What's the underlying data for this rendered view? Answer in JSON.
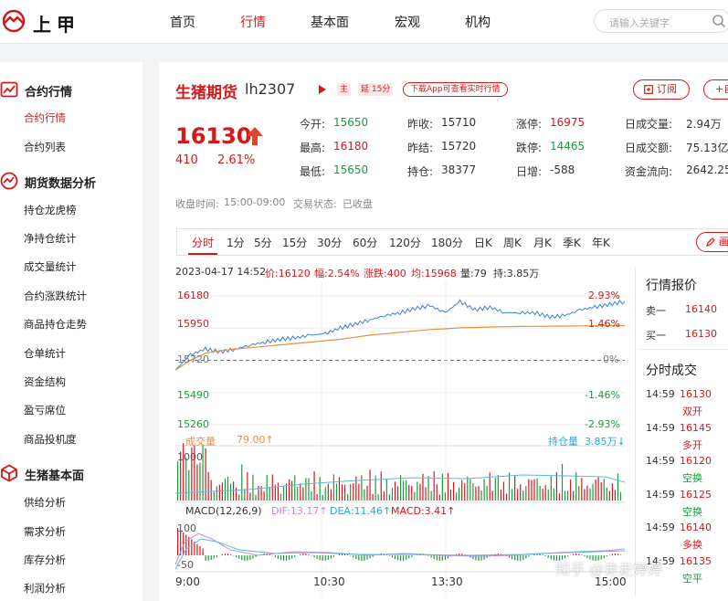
{
  "brand": {
    "name": "上甲",
    "accent": "#d5181c",
    "up": "#d5181c",
    "down": "#1a9b3a"
  },
  "nav": [
    "首页",
    "行情",
    "基本面",
    "宏观",
    "机构"
  ],
  "search": {
    "placeholder": "请输入关键字"
  },
  "sidebar": [
    {
      "title": "合约行情",
      "icon": "chart-line-icon",
      "items": [
        "合约行情",
        "合约列表"
      ],
      "active": "合约行情"
    },
    {
      "title": "期货数据分析",
      "icon": "trend-icon",
      "items": [
        "持仓龙虎榜",
        "净持仓统计",
        "成交量统计",
        "合约涨跌统计",
        "商品持仓走势",
        "仓单统计",
        "资金结构",
        "盈亏席位",
        "商品投机度"
      ]
    },
    {
      "title": "生猪基本面",
      "icon": "cube-icon",
      "items": [
        "供给分析",
        "需求分析",
        "库存分析",
        "利润分析"
      ]
    }
  ],
  "contract": {
    "name": "生猪期货",
    "code": "lh2307",
    "tag_main": "主",
    "tag_delay": "延 15分",
    "app_tip": "下载App可查看实时行情",
    "subscribe": "订阅",
    "add": "+自",
    "price": "16130",
    "change": "410",
    "change_pct": "2.61%",
    "status_time_label": "收盘时间:",
    "status_time": "15:00-09:00",
    "trade_status_label": "交易状态:",
    "trade_status": "已收盘"
  },
  "quote": [
    {
      "label": "今开:",
      "value": "15650",
      "color": "green"
    },
    {
      "label": "昨收:",
      "value": "15710",
      "color": "plain"
    },
    {
      "label": "涨停:",
      "value": "16975",
      "color": "red"
    },
    {
      "label": "日成交量:",
      "value": "2.94万",
      "color": "plain"
    },
    {
      "label": "最高:",
      "value": "16180",
      "color": "red"
    },
    {
      "label": "昨结:",
      "value": "15720",
      "color": "plain"
    },
    {
      "label": "跌停:",
      "value": "14465",
      "color": "green"
    },
    {
      "label": "日成交额:",
      "value": "75.13亿",
      "color": "plain"
    },
    {
      "label": "最低:",
      "value": "15650",
      "color": "green"
    },
    {
      "label": "持仓:",
      "value": "38377",
      "color": "plain"
    },
    {
      "label": "日增:",
      "value": "-588",
      "color": "plain"
    },
    {
      "label": "资金流向:",
      "value": "2642.25",
      "color": "plain"
    }
  ],
  "tabs": [
    "分时",
    "1分",
    "5分",
    "15分",
    "30分",
    "60分",
    "120分",
    "180分",
    "日K",
    "周K",
    "月K",
    "季K",
    "年K"
  ],
  "active_tab": "分时",
  "draw_btn": "画",
  "infobar": {
    "date": "2023-04-17 14:52",
    "price": "价:16120",
    "amp": "幅:2.54%",
    "rise": "涨跌:400",
    "avg": "均:15968",
    "vol": "量:79",
    "hold": "持:3.85万"
  },
  "chart_data": {
    "type": "line",
    "y_ticks": [
      "16180",
      "15950",
      "15720",
      "15490",
      "15260"
    ],
    "pct_ticks": [
      "2.93%",
      "1.46%",
      "0%",
      "-1.46%",
      "-2.93%"
    ],
    "x_ticks": [
      "9:00",
      "10:30",
      "13:30",
      "15:00"
    ],
    "ylim": [
      15260,
      16180
    ],
    "series": [
      {
        "values": [
          15650,
          15760,
          15800,
          15780,
          15800,
          15830,
          15850,
          15870,
          15880,
          15900,
          15910,
          15950,
          15980,
          16010,
          16040,
          16060,
          16090,
          16110,
          16060,
          16140,
          16080,
          16100,
          16060,
          16060,
          16060,
          16030,
          16040,
          16080,
          16100,
          16120,
          16140
        ]
      },
      {
        "values": [
          15650,
          15720,
          15770,
          15790,
          15800,
          15810,
          15820,
          15830,
          15840,
          15850,
          15860,
          15870,
          15885,
          15900,
          15910,
          15920,
          15930,
          15940,
          15945,
          15952,
          15955,
          15958,
          15960,
          15962,
          15963,
          15964,
          15965,
          15966,
          15967,
          15968,
          15968
        ]
      }
    ],
    "volume": {
      "label": "成交量",
      "value": "79.00↑",
      "y_max": "1000",
      "hold_label": "持仓量",
      "hold_value": "3.85万↓"
    },
    "macd": {
      "params": "MACD(12,26,9)",
      "dif": "DIF:13.17↑",
      "dea": "DEA:11.46↑",
      "macd": "MACD:3.41↑",
      "y_max": "100",
      "y_min": "-50"
    }
  },
  "orderbook": {
    "title": "行情报价",
    "sell_label": "卖一",
    "sell_price": "16140",
    "buy_label": "买一",
    "buy_price": "16130"
  },
  "trades": {
    "title": "分时成交",
    "rows": [
      {
        "time": "14:59",
        "price": "16130",
        "type": "双开"
      },
      {
        "time": "14:59",
        "price": "16145",
        "type": "多开"
      },
      {
        "time": "14:59",
        "price": "16120",
        "type": "空换"
      },
      {
        "time": "14:59",
        "price": "16125",
        "type": "空换"
      },
      {
        "time": "14:59",
        "price": "16140",
        "type": "多换"
      },
      {
        "time": "14:59",
        "price": "16135",
        "type": "空平"
      }
    ]
  },
  "watermark": "知乎 @走走婷婷"
}
